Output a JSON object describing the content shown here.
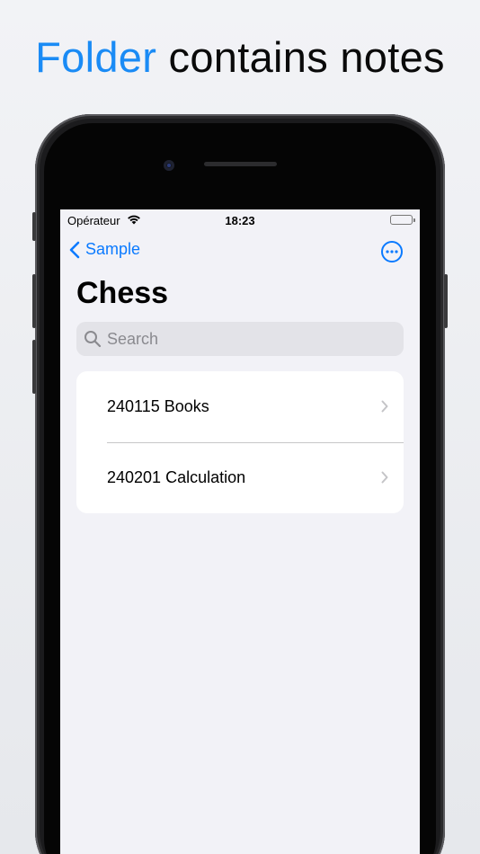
{
  "headline": {
    "accent": "Folder",
    "rest": "contains notes"
  },
  "status_bar": {
    "carrier": "Opérateur",
    "time": "18:23"
  },
  "nav": {
    "back_label": "Sample",
    "more_icon": "ellipsis-circle-icon"
  },
  "page": {
    "title": "Chess"
  },
  "search": {
    "placeholder": "Search",
    "value": ""
  },
  "notes": [
    {
      "label": "240115 Books"
    },
    {
      "label": "240201 Calculation"
    }
  ],
  "colors": {
    "accent": "#1a8bf5",
    "tint": "#0a7aff",
    "background": "#f2f2f7"
  }
}
